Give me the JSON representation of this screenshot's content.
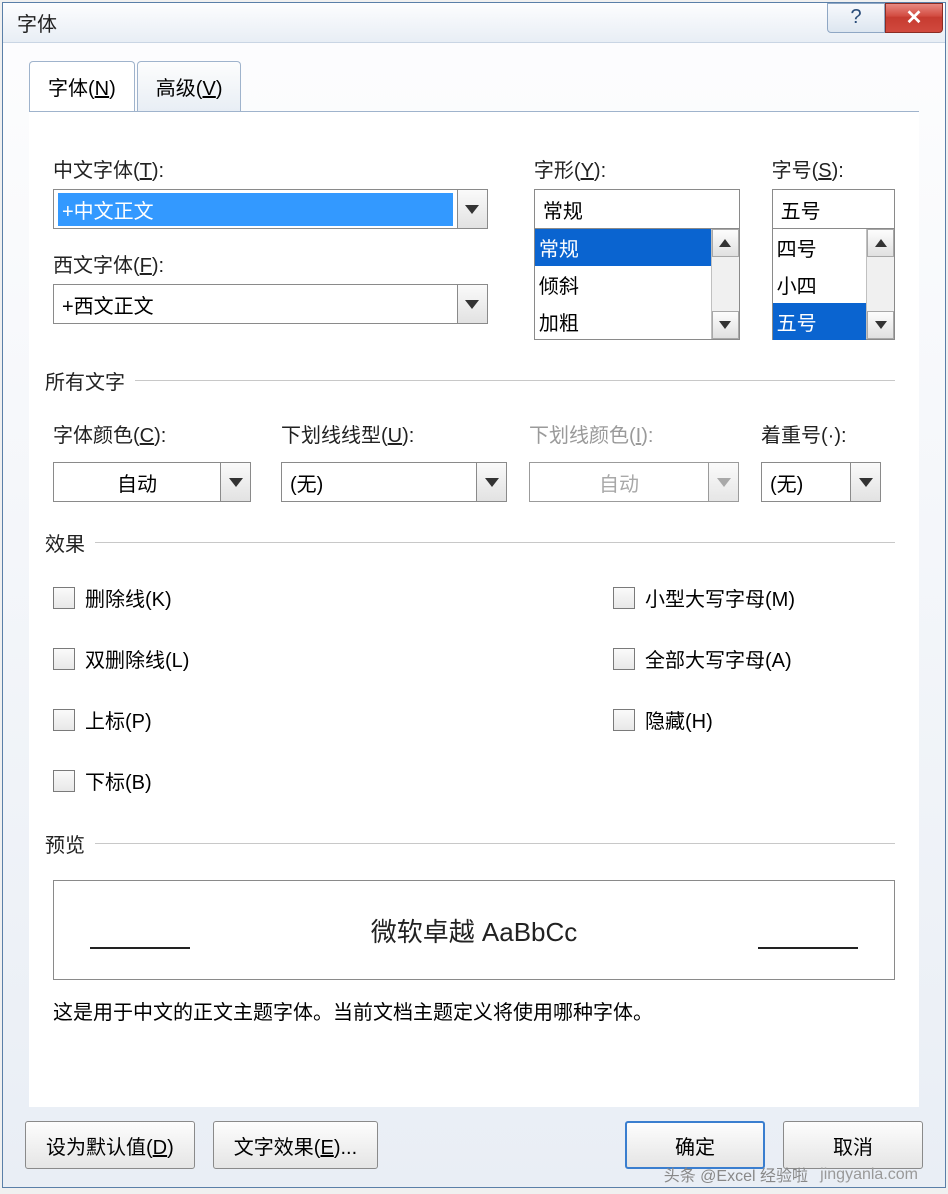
{
  "title": "字体",
  "tabs": {
    "t0": "字体(N)",
    "t1": "高级(V)"
  },
  "labels": {
    "chinese": "中文字体(T):",
    "western": "西文字体(F):",
    "style": "字形(Y):",
    "size": "字号(S):",
    "fontColor": "字体颜色(C):",
    "underlineStyle": "下划线线型(U):",
    "underlineColor": "下划线颜色(I):",
    "emphasis": "着重号(·):"
  },
  "values": {
    "chinese": "+中文正文",
    "western": "+西文正文",
    "style": "常规",
    "size": "五号",
    "fontColor": "自动",
    "underlineStyle": "(无)",
    "underlineColor": "自动",
    "emphasis": "(无)"
  },
  "styleOptions": [
    "常规",
    "倾斜",
    "加粗"
  ],
  "sizeOptions": [
    "四号",
    "小四",
    "五号"
  ],
  "sections": {
    "allText": "所有文字",
    "effects": "效果",
    "preview": "预览"
  },
  "effectsLeft": [
    "删除线(K)",
    "双删除线(L)",
    "上标(P)",
    "下标(B)"
  ],
  "effectsRight": [
    "小型大写字母(M)",
    "全部大写字母(A)",
    "隐藏(H)"
  ],
  "preview": {
    "text": "微软卓越 AaBbCc"
  },
  "desc": "这是用于中文的正文主题字体。当前文档主题定义将使用哪种字体。",
  "buttons": {
    "default": "设为默认值(D)",
    "textfx": "文字效果(E)...",
    "ok": "确定",
    "cancel": "取消"
  },
  "watermark": "jingyanla.com",
  "watermark2": "头条 @Excel 经验啦"
}
